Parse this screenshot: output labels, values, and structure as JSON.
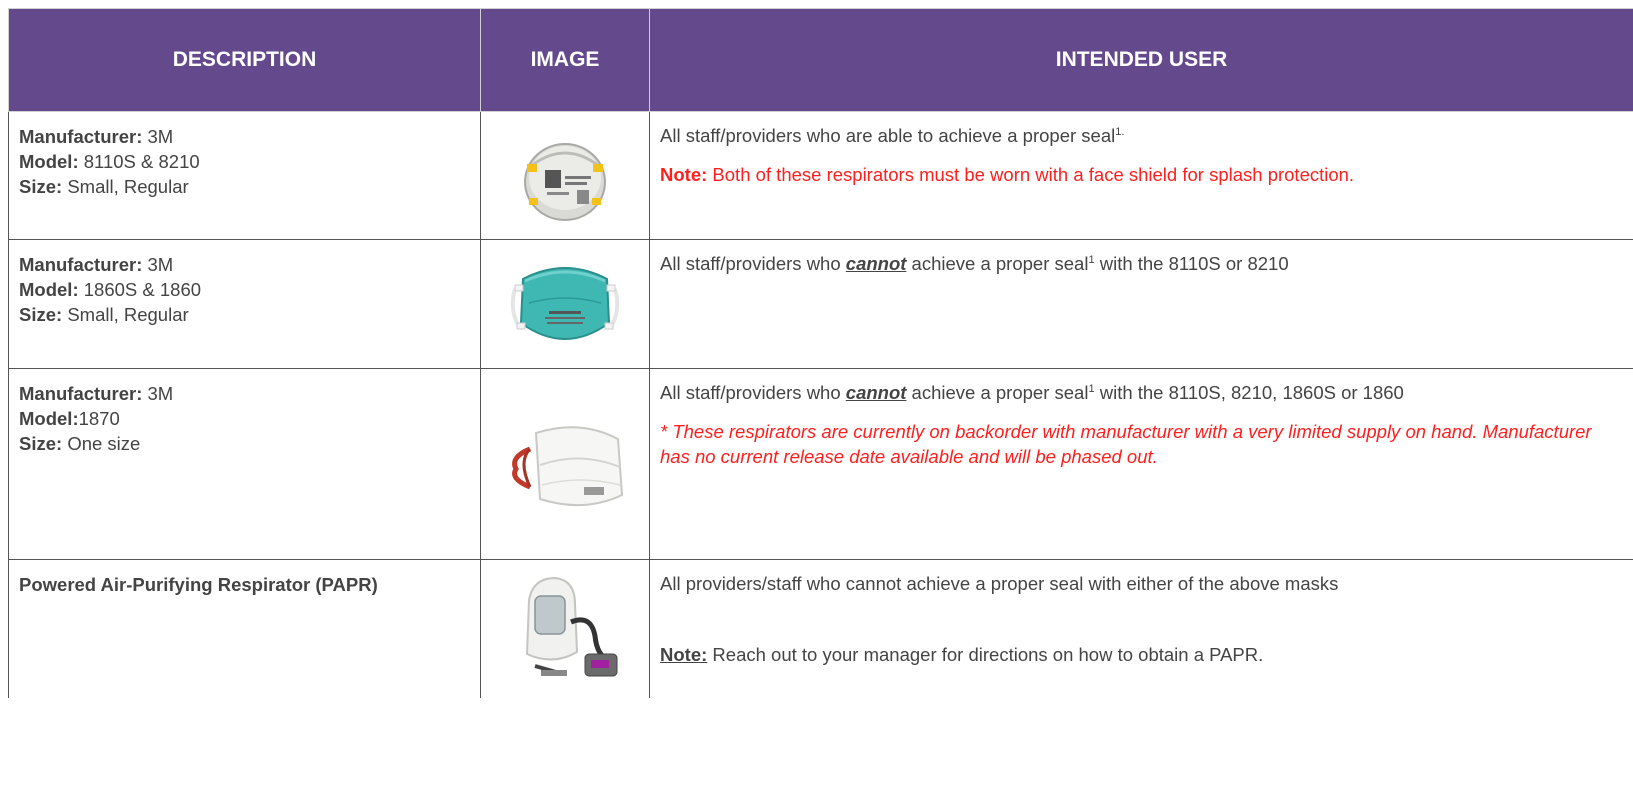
{
  "header": {
    "col_description": "DESCRIPTION",
    "col_image": "IMAGE",
    "col_intended_user": "INTENDED USER"
  },
  "rows": [
    {
      "manufacturer_label": "Manufacturer:",
      "manufacturer": " 3M",
      "model_label": "Model:",
      "model": " 8110S & 8210",
      "size_label": "Size:",
      "size": " Small, Regular",
      "image_icon": "white-n95-respirator-icon",
      "user_text": "All staff/providers who are able to achieve a proper seal",
      "user_sup": "1.",
      "note_label": "Note:",
      "note_text": " Both of these respirators must be worn with a face shield for splash protection."
    },
    {
      "manufacturer_label": "Manufacturer:",
      "manufacturer": " 3M",
      "model_label": "Model:",
      "model": " 1860S & 1860",
      "size_label": "Size:",
      "size": " Small, Regular",
      "image_icon": "teal-n95-respirator-icon",
      "user_pre": "All staff/providers who ",
      "user_emph": "cannot",
      "user_mid": " achieve a proper seal",
      "user_sup": "1",
      "user_post": " with the 8110S or 8210"
    },
    {
      "manufacturer_label": "Manufacturer:",
      "manufacturer": " 3M",
      "model_label": "Model:",
      "model": "1870",
      "size_label": "Size:",
      "size": " One size",
      "image_icon": "flat-fold-respirator-icon",
      "user_pre": "All staff/providers who ",
      "user_emph": "cannot",
      "user_mid": " achieve a proper seal",
      "user_sup": "1",
      "user_post": " with the 8110S, 8210, 1860S or 1860",
      "backorder_note": "* These respirators are currently on backorder with manufacturer with a very limited supply on hand. Manufacturer has no current release date available and will be phased out."
    },
    {
      "description": "Powered Air-Purifying Respirator (PAPR)",
      "image_icon": "papr-hood-icon",
      "user_text": "All providers/staff who cannot achieve a proper seal with either of the above masks",
      "note_label": "Note:",
      "note_text": " Reach out to your manager for directions on how to obtain a PAPR."
    }
  ],
  "colors": {
    "header_bg": "#644a8d",
    "header_text": "#ffffff",
    "body_text": "#444444",
    "warning_red": "#ff1f1f"
  }
}
